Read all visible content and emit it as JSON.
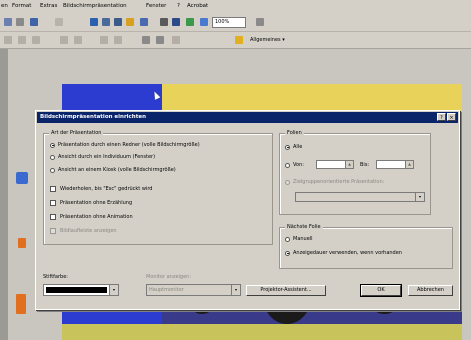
{
  "menubar": {
    "items": [
      "en",
      "Format",
      "Extras",
      "Bildschirmpräsentation",
      "Fenster",
      "?",
      "Acrobat"
    ]
  },
  "toolbar": {
    "zoom": "100%",
    "design_label": "Allgemeines"
  },
  "dialog": {
    "title": "Bildschirmpräsentation einrichten",
    "help_btn": "?",
    "close_btn": "×",
    "art": {
      "label": "Art der Präsentation",
      "opt1": "Präsentation durch einen Redner (volle Bildschirmgröße)",
      "opt2": "Ansicht durch ein Individuum (Fenster)",
      "opt3": "Ansicht an einem Kiosk (volle Bildschirmgröße)",
      "chk1": "Wiederholen, bis \"Esc\" gedrückt wird",
      "chk2": "Präsentation ohne Erzählung",
      "chk3": "Präsentation ohne Animation",
      "chk4": "Bildlaufleiste anzeigen"
    },
    "folien": {
      "label": "Folien",
      "alle": "Alle",
      "von": "Von:",
      "bis": "Bis:",
      "custom": "Zielgruppenorientierte Präsentation:"
    },
    "naechste": {
      "label": "Nächste Folie",
      "manuell": "Manuell",
      "timing": "Anzeigedauer verwenden, wenn vorhanden"
    },
    "stift": {
      "label": "Stiftfarbe:",
      "color": "#000000"
    },
    "monitor": {
      "label": "Monitor anzeigen:",
      "value": "Hauptmonitor"
    },
    "buttons": {
      "projektor": "Projektor-Assistent...",
      "ok": "OK",
      "abbrechen": "Abbrechen"
    }
  },
  "colors": {
    "title_bar": "#0a246a",
    "dialog_bg": "#d4d0c8"
  }
}
